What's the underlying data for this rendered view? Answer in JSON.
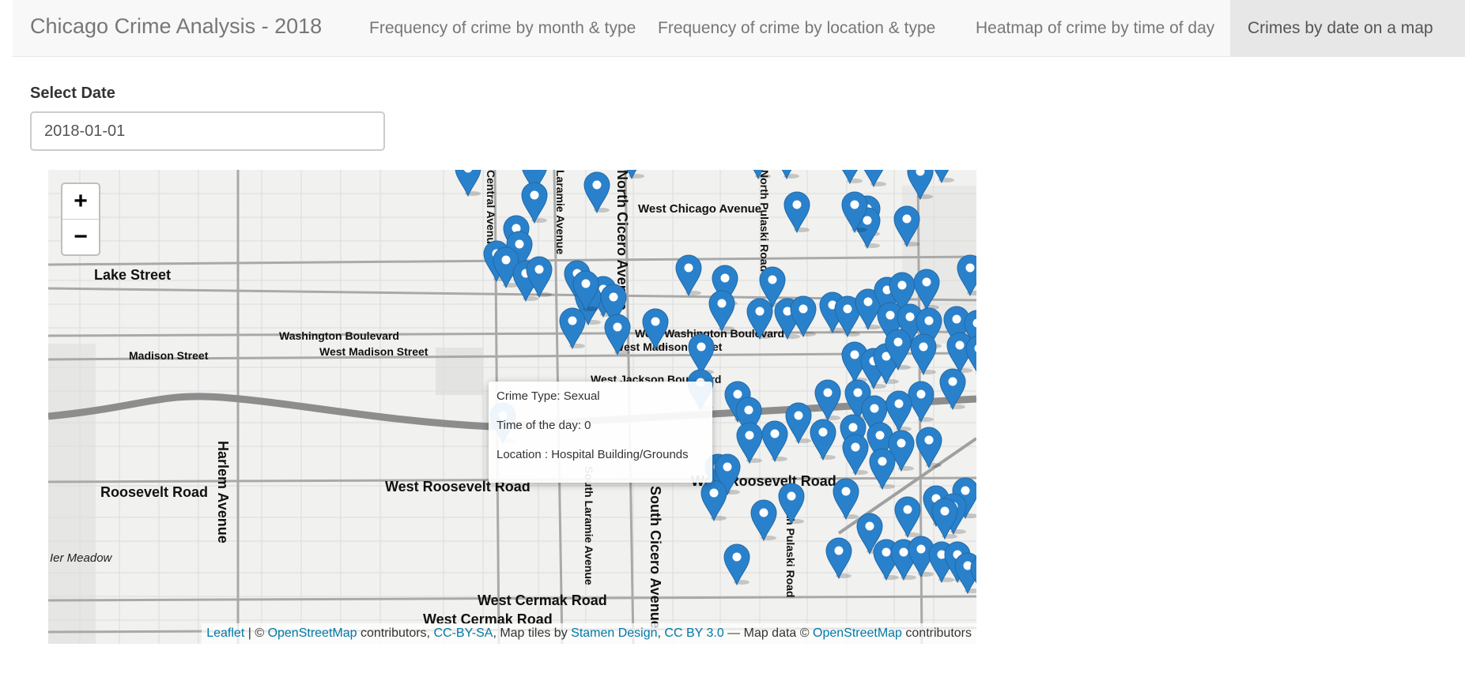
{
  "navbar": {
    "brand": "Chicago Crime Analysis - 2018",
    "tabs": [
      {
        "label": "Frequency of crime by month & type"
      },
      {
        "label": "Frequency of crime by location & type"
      },
      {
        "label": "Heatmap of crime by time of day"
      },
      {
        "label": "Crimes by date on a map",
        "active": true
      }
    ]
  },
  "form": {
    "date_label": "Select Date",
    "date_value": "2018-01-01"
  },
  "map": {
    "zoom_in": "+",
    "zoom_out": "−",
    "marker_color": "#2a81cb",
    "streets": {
      "lake": "Lake Street",
      "washington": "Washington Boulevard",
      "madison": "Madison Street",
      "west_madison": "West Madison Street",
      "roosevelt": "Roosevelt Road",
      "west_roosevelt": "West Roosevelt Road",
      "harlem": "Harlem Avenue",
      "west_cermak_1": "West Cermak Road",
      "west_cermak_2": "West Cermak Road",
      "central": "Central Avenue",
      "laramie": "Laramie Avenue",
      "cicero": "North Cicero Avenue",
      "west_chicago": "West Chicago Avenue",
      "pulaski": "North Pulaski Road",
      "south_laramie": "South Laramie Avenue",
      "south_cicero": "South Cicero Avenue",
      "south_pulaski": "South Pulaski Road",
      "meadow": "Ier Meadow",
      "jackson": "West Jackson Boulevard",
      "west_washington": "West Washington Boulevard",
      "west_madison_2": "West Madison Street",
      "west_roosevelt_2": "West Roosevelt Road"
    },
    "popup": {
      "crime_type": "Crime Type: Sexual",
      "time_of_day": "Time of the day: 0",
      "location": "Location : Hospital Building/Grounds"
    },
    "attribution": {
      "leaflet": "Leaflet",
      "sep1": " | © ",
      "osm": "OpenStreetMap",
      "t1": " contributors, ",
      "ccbysa": "CC-BY-SA",
      "t2": ", Map tiles by ",
      "stamen": "Stamen Design",
      "t3": ", ",
      "ccby": "CC BY 3.0",
      "t4": " — Map data © ",
      "osm2": "OpenStreetMap",
      "t5": " contributors"
    }
  }
}
